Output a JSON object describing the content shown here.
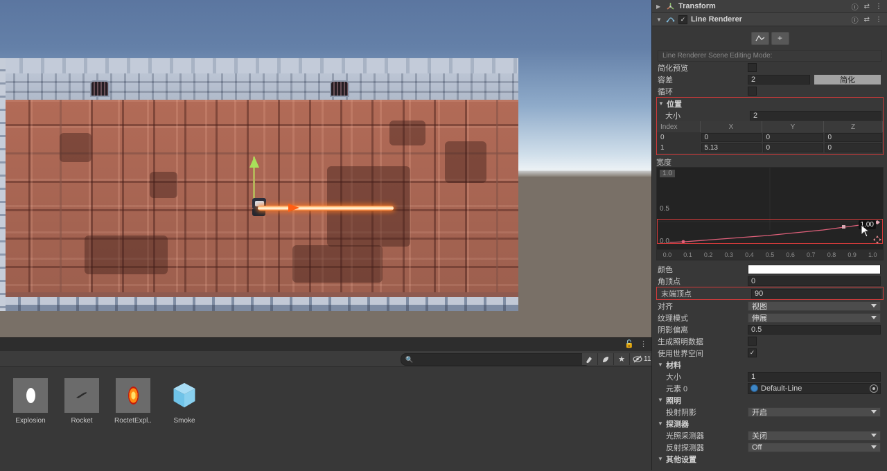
{
  "scene": {
    "name": "scene-view",
    "description": "2D brick wall level with player character firing an orange laser beam",
    "gizmo_axis": "y-axis-green-arrow"
  },
  "project_panel": {
    "search_placeholder": "",
    "search_value": "",
    "hidden_count": "11",
    "icons": {
      "lock": "lock-icon",
      "menu": "kebab-menu-icon",
      "search": "search-icon",
      "paint": "paint-icon",
      "leaf": "leaf-icon",
      "star": "star-icon",
      "eye_off": "eye-off-icon"
    },
    "assets": [
      {
        "label": "Explosion",
        "icon": "explosion-particle-icon"
      },
      {
        "label": "Rocket",
        "icon": "rocket-icon"
      },
      {
        "label": "RoctetExpl..",
        "icon": "rocket-explosion-icon"
      },
      {
        "label": "Smoke",
        "icon": "smoke-prefab-cube-icon"
      }
    ]
  },
  "inspector": {
    "components": [
      {
        "title": "Transform",
        "icon": "transform-icon",
        "expanded": false,
        "has_checkbox": false
      },
      {
        "title": "Line Renderer",
        "icon": "line-renderer-icon",
        "expanded": true,
        "has_checkbox": true,
        "enabled": true
      }
    ],
    "header_icons": {
      "help": "help-icon",
      "preset": "preset-icon",
      "menu": "kebab-menu-icon"
    },
    "curve_tools": {
      "edit_icon": "curve-edit-icon",
      "add_icon": "plus-icon"
    },
    "edit_mode_bar": "Line Renderer Scene Editing Mode:",
    "simplify_preview": {
      "label": "简化预览",
      "checked": false
    },
    "tolerance": {
      "label": "容差",
      "value": "2",
      "button": "简化"
    },
    "loop": {
      "label": "循环",
      "checked": false
    },
    "positions": {
      "title": "位置",
      "size_label": "大小",
      "size_value": "2",
      "columns": [
        "Index",
        "X",
        "Y",
        "Z"
      ],
      "rows": [
        {
          "index": "0",
          "x": "0",
          "y": "0",
          "z": "0"
        },
        {
          "index": "1",
          "x": "5.13",
          "y": "0",
          "z": "0"
        }
      ],
      "highlighted": true
    },
    "width": {
      "title": "宽度",
      "y_labels": [
        "1.0",
        "0.5",
        "0.0"
      ],
      "x_labels": [
        "0.0",
        "0.1",
        "0.2",
        "0.3",
        "0.4",
        "0.5",
        "0.6",
        "0.7",
        "0.8",
        "0.9",
        "1.0"
      ],
      "tooltip_value": "1.00",
      "curve_color": "#e0607a"
    },
    "color": {
      "label": "颜色",
      "value_color": "#ffffff"
    },
    "corner_vertices": {
      "label": "角顶点",
      "value": "0"
    },
    "end_cap_vertices": {
      "label": "末端顶点",
      "value": "90",
      "highlighted": true
    },
    "alignment": {
      "label": "对齐",
      "value": "视图"
    },
    "texture_mode": {
      "label": "纹理模式",
      "value": "伸展"
    },
    "shadow_bias": {
      "label": "阴影偏离",
      "value": "0.5"
    },
    "generate_lighting_data": {
      "label": "生成照明数据",
      "checked": false
    },
    "use_world_space": {
      "label": "使用世界空间",
      "checked": true
    },
    "material": {
      "title": "材料",
      "size_label": "大小",
      "size_value": "1",
      "element_label": "元素 0",
      "element_value": "Default-Line"
    },
    "lighting": {
      "title": "照明",
      "cast_shadows_label": "投射阴影",
      "cast_shadows_value": "开启"
    },
    "probes": {
      "title": "探测器",
      "light_probes_label": "光照采测器",
      "light_probes_value": "关闭",
      "reflection_probes_label": "反射探测器",
      "reflection_probes_value": "Off"
    },
    "other_settings": {
      "title": "其他设置"
    }
  },
  "chart_data": {
    "type": "line",
    "title": "宽度",
    "xlabel": "",
    "ylabel": "",
    "xlim": [
      0.0,
      1.0
    ],
    "ylim": [
      0.0,
      1.0
    ],
    "grid": true,
    "x": [
      0.0,
      0.05,
      0.2,
      0.3,
      0.4,
      0.5,
      0.6,
      0.7,
      0.8,
      0.9,
      1.0
    ],
    "values": [
      0.04,
      0.045,
      0.06,
      0.07,
      0.08,
      0.09,
      0.105,
      0.115,
      0.13,
      0.14,
      0.155
    ],
    "series": [
      {
        "name": "width",
        "values": [
          0.04,
          0.045,
          0.06,
          0.07,
          0.08,
          0.09,
          0.105,
          0.115,
          0.13,
          0.14,
          0.155
        ]
      }
    ],
    "keyframes": [
      {
        "x": 0.05,
        "y": 0.04
      },
      {
        "x": 0.9,
        "y": 0.14
      },
      {
        "x": 1.0,
        "y": 0.155
      }
    ],
    "tick_labels_x": [
      "0.0",
      "0.1",
      "0.2",
      "0.3",
      "0.4",
      "0.5",
      "0.6",
      "0.7",
      "0.8",
      "0.9",
      "1.0"
    ],
    "tick_labels_y": [
      "0.0",
      "0.5",
      "1.0"
    ],
    "annotation": "1.00"
  }
}
